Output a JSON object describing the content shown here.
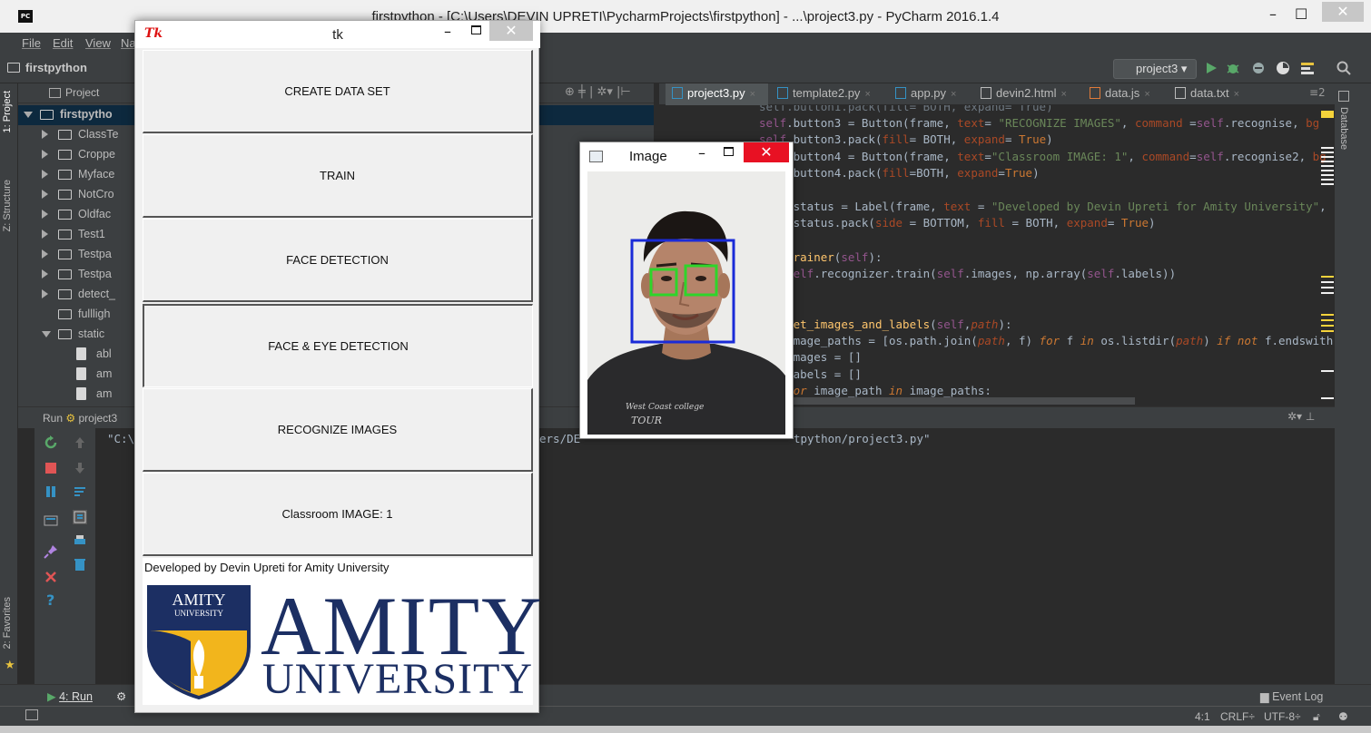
{
  "ide": {
    "title": "firstpython - [C:\\Users\\DEVIN UPRETI\\PycharmProjects\\firstpython] - ...\\project3.py - PyCharm 2016.1.4",
    "app_icon_text": "PC",
    "menu": [
      "File",
      "Edit",
      "View",
      "Na"
    ],
    "breadcrumb": "firstpython",
    "run_config": "project3",
    "left_tabs": [
      "1: Project",
      "Z: Structure",
      "2: Favorites"
    ],
    "right_tab": "Database",
    "project_header": "Project",
    "tree": [
      {
        "label": "firstpytho",
        "type": "folder",
        "state": "open",
        "selected": true
      },
      {
        "label": "ClassTe",
        "type": "folder",
        "state": "closed"
      },
      {
        "label": "Croppe",
        "type": "folder",
        "state": "closed"
      },
      {
        "label": "Myface",
        "type": "folder",
        "state": "closed"
      },
      {
        "label": "NotCro",
        "type": "folder",
        "state": "closed"
      },
      {
        "label": "Oldfac",
        "type": "folder",
        "state": "closed"
      },
      {
        "label": "Test1",
        "type": "folder",
        "state": "closed"
      },
      {
        "label": "Testpa",
        "type": "folder",
        "state": "closed"
      },
      {
        "label": "Testpa",
        "type": "folder",
        "state": "closed"
      },
      {
        "label": "detect_",
        "type": "folder",
        "state": "closed"
      },
      {
        "label": "fullligh",
        "type": "folder",
        "state": "none"
      },
      {
        "label": "static",
        "type": "folder",
        "state": "open"
      },
      {
        "label": "abl",
        "type": "file"
      },
      {
        "label": "am",
        "type": "file"
      },
      {
        "label": "am",
        "type": "file"
      }
    ],
    "editor_tabs": [
      {
        "label": "project3.py",
        "active": true
      },
      {
        "label": "template2.py"
      },
      {
        "label": "app.py"
      },
      {
        "label": "devin2.html"
      },
      {
        "label": "data.js"
      },
      {
        "label": "data.txt"
      }
    ],
    "tabs_overflow": "≡2",
    "run_panel_label": "Run",
    "run_panel_config": "project3",
    "console_left": "\"C:\\",
    "console_mid": "ers/DE",
    "console_right": "tpython/project3.py\"",
    "bottom_run_tab": "4: Run",
    "event_log": "Event Log",
    "status_position": "4:1",
    "status_line_sep": "CRLF",
    "status_encoding": "UTF-8"
  },
  "code": {
    "l1": "self.button3 = Button(frame, text= \"RECOGNIZE IMAGES\", command =self.recognise, bg",
    "l2": "self.button3.pack(fill= BOTH, expand= True)",
    "l3": "self.button4 = Button(frame, text=\"Classroom IMAGE: 1\", command=self.recognise2, bg",
    "l4": "self.button4.pack(fill=BOTH, expand=True)",
    "l5": "self.status = Label(frame, text = \"Developed by Devin Upreti for Amity University\",",
    "l6": "self.status.pack(side = BOTTOM, fill = BOTH, expand= True)",
    "l7": "def trainer(self):",
    "l8": "    self.recognizer.train(self.images, np.array(self.labels))",
    "l9": "def get_images_and_labels(self,path):",
    "l10": "    image_paths = [os.path.join(path, f) for f in os.listdir(path) if not f.endswith('.s",
    "l11": "    images = []",
    "l12": "    labels = []",
    "l13": "    for image_path in image_paths:"
  },
  "tk_window": {
    "title": "tk",
    "logo": "Tk",
    "buttons": [
      "CREATE DATA SET",
      "TRAIN",
      "FACE DETECTION",
      "FACE & EYE DETECTION",
      "RECOGNIZE IMAGES",
      "Classroom IMAGE: 1"
    ],
    "status": "Developed by Devin Upreti for Amity University",
    "brand_big": "AMITY",
    "brand_small": "UNIVERSITY",
    "shield_text_1": "AMITY",
    "shield_text_2": "UNIVERSITY"
  },
  "image_window": {
    "title": "Image",
    "shirt_text_1": "West Coast college",
    "shirt_text_2": "TOUR"
  },
  "colors": {
    "ide_bg": "#2b2b2b",
    "amity_blue": "#1c2f63",
    "amity_gold": "#f2b51c",
    "face_box": "#1a2bd8",
    "eye_box": "#2ed52a",
    "close_red": "#e81123"
  }
}
